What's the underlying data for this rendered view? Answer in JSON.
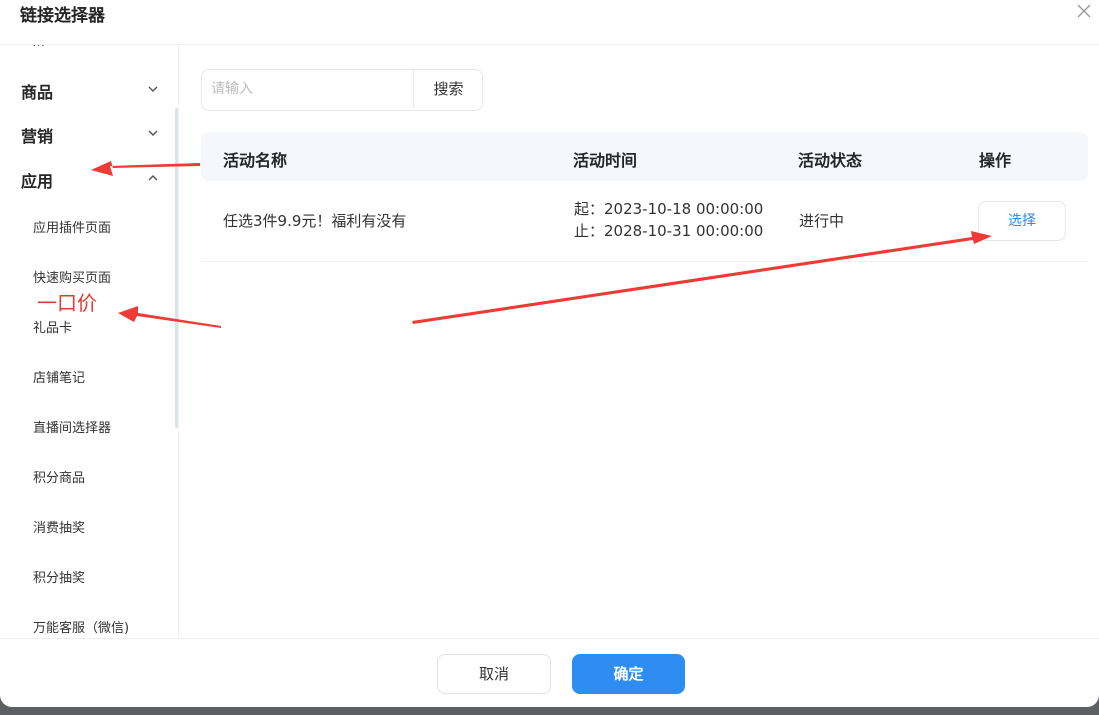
{
  "dialog": {
    "title": "链接选择器",
    "close_icon": "close-icon"
  },
  "sidebar": {
    "cut_item": "…",
    "groups": [
      {
        "label": "商品",
        "expanded": false
      },
      {
        "label": "营销",
        "expanded": false
      },
      {
        "label": "应用",
        "expanded": true
      }
    ],
    "items": [
      {
        "label": "应用插件页面"
      },
      {
        "label": "快速购买页面"
      },
      {
        "label": "礼品卡"
      },
      {
        "label": "店铺笔记"
      },
      {
        "label": "直播间选择器"
      },
      {
        "label": "积分商品"
      },
      {
        "label": "消费抽奖"
      },
      {
        "label": "积分抽奖"
      },
      {
        "label": "万能客服（微信)"
      }
    ]
  },
  "search": {
    "placeholder": "请输入",
    "value": "",
    "button_label": "搜索"
  },
  "table": {
    "columns": [
      "活动名称",
      "活动时间",
      "活动状态",
      "操作"
    ],
    "rows": [
      {
        "name": "任选3件9.9元！福利有没有",
        "start": "起：2023-10-18 00:00:00",
        "end": "止：2028-10-31 00:00:00",
        "status": "进行中",
        "action": "选择"
      }
    ]
  },
  "footer": {
    "cancel_label": "取消",
    "confirm_label": "确定"
  },
  "annotation": {
    "text": "一口价",
    "color": "#e53935"
  },
  "colors": {
    "accent": "#2f8cf0",
    "link": "#2f88ea"
  }
}
